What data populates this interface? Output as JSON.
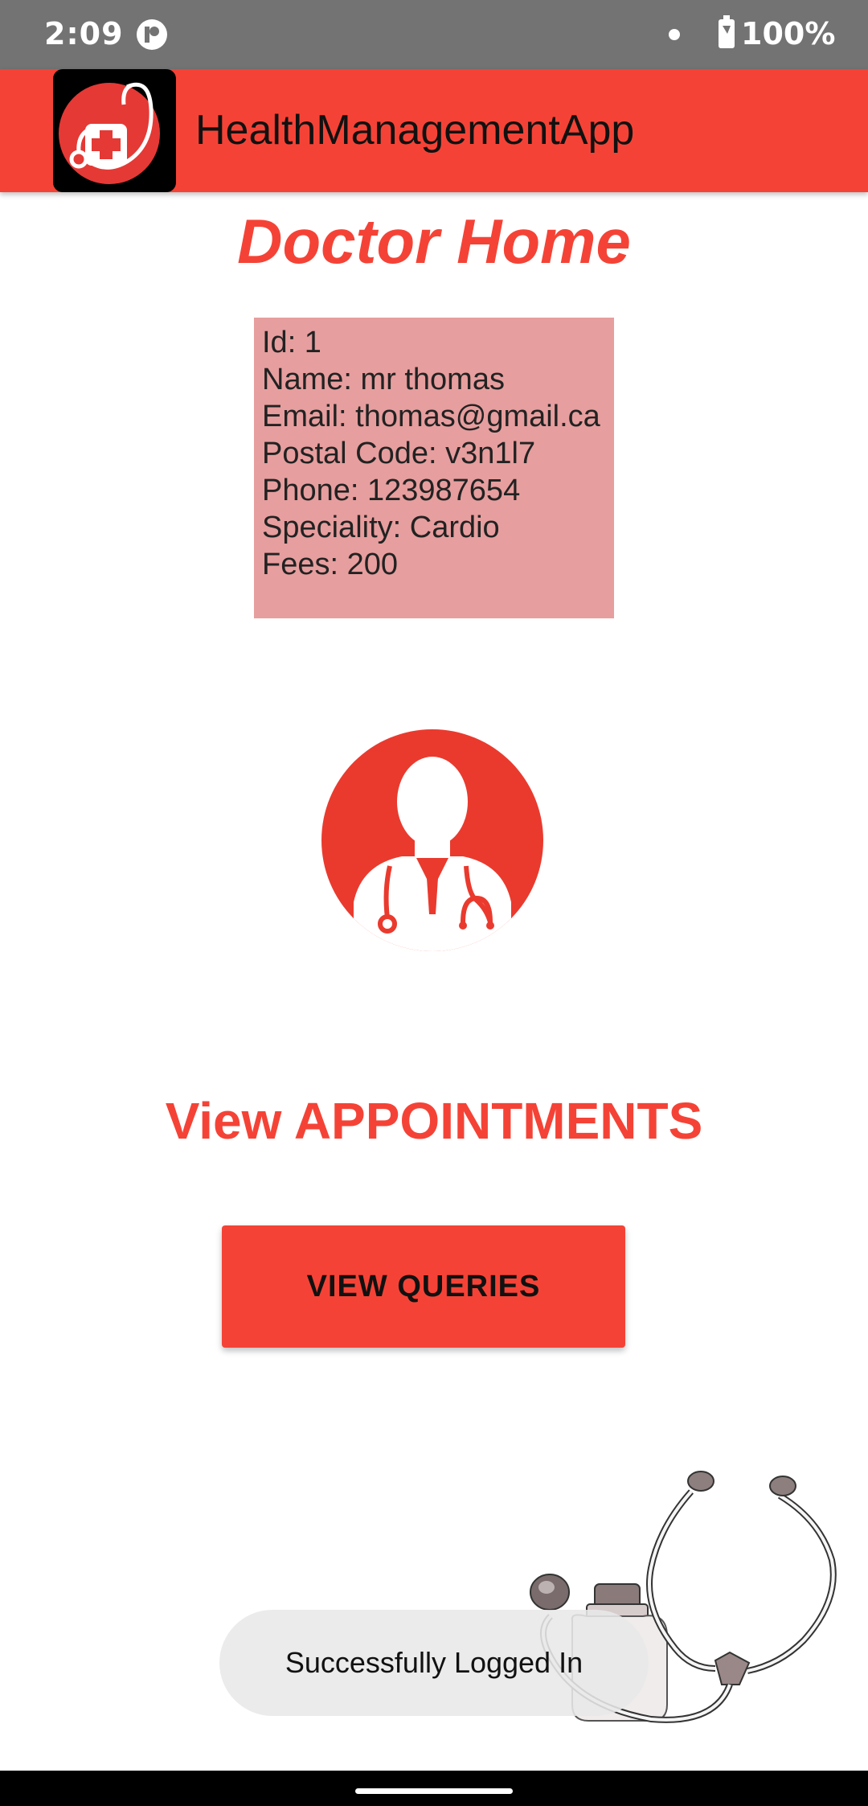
{
  "status_bar": {
    "time": "2:09",
    "battery": "100%",
    "icons": [
      "app-notification-icon",
      "dot-icon",
      "battery-charging-icon"
    ]
  },
  "app_bar": {
    "title": "HealthManagementApp",
    "logo_icon": "stethoscope-medical-cross-icon"
  },
  "page": {
    "title": "Doctor Home"
  },
  "doctor_info": {
    "id": "Id: 1",
    "name": "Name: mr thomas",
    "email": "Email: thomas@gmail.ca",
    "postal_code": "Postal Code: v3n1l7",
    "phone": "Phone: 123987654",
    "speciality": "Speciality: Cardio",
    "fees": "Fees: 200"
  },
  "avatar": {
    "icon": "doctor-avatar-icon"
  },
  "actions": {
    "appointments_label": "View APPOINTMENTS",
    "queries_label": "VIEW QUERIES"
  },
  "toast": {
    "message": "Successfully Logged In"
  },
  "colors": {
    "primary": "#f44336",
    "card": "#e79e9e",
    "status_bar": "#737373"
  }
}
